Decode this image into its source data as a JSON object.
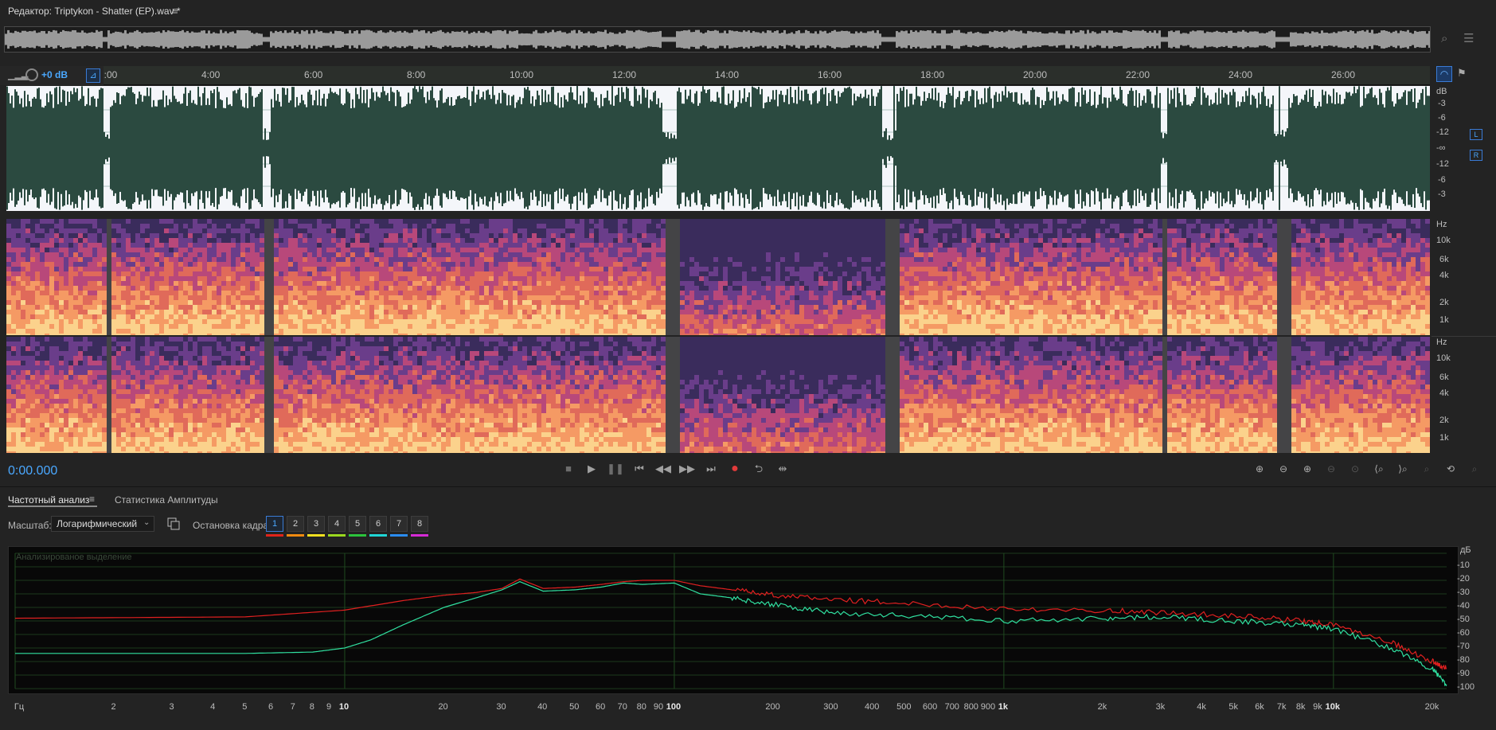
{
  "window": {
    "title": "Редактор: Triptykon - Shatter (EP).wav *"
  },
  "ruler": {
    "gain": "+0 dB",
    "ticks": [
      "2:00",
      "4:00",
      "6:00",
      "8:00",
      "10:00",
      "12:00",
      "14:00",
      "16:00",
      "18:00",
      "20:00",
      "22:00",
      "24:00",
      "26:00"
    ]
  },
  "waveform": {
    "db_labels": [
      "dB",
      "-3",
      "-6",
      "-12",
      "-∞",
      "-12",
      "-6",
      "-3"
    ],
    "channels": [
      "L",
      "R"
    ]
  },
  "spectrogram": {
    "top_labels": [
      "Hz",
      "10k",
      "6k",
      "4k",
      "2k",
      "1k"
    ],
    "bottom_labels": [
      "Hz",
      "10k",
      "6k",
      "4k",
      "2k",
      "1k"
    ]
  },
  "transport": {
    "timecode": "0:00.000",
    "buttons": [
      "stop-icon",
      "play-icon",
      "pause-icon",
      "skip-start-icon",
      "rewind-icon",
      "fast-forward-icon",
      "skip-end-icon",
      "record-icon",
      "loop-icon",
      "skip-selection-icon"
    ],
    "zoom_buttons": [
      "zoom-in-amplitude-icon",
      "zoom-out-amplitude-icon",
      "zoom-in-time-icon",
      "zoom-out-time-icon",
      "zoom-full-icon",
      "zoom-in-start-icon",
      "zoom-in-end-icon",
      "zoom-selection-icon",
      "zoom-reset-icon",
      "zoom-tracks-icon"
    ]
  },
  "panel": {
    "tabs": [
      "Частотный анализ",
      "Статистика Амплитуды"
    ],
    "scale_label": "Масштаб:",
    "scale_value": "Логарифмический",
    "hold_label": "Остановка кадра:",
    "hold_buttons": [
      "1",
      "2",
      "3",
      "4",
      "5",
      "6",
      "7",
      "8"
    ],
    "hold_colors": [
      "#e0241b",
      "#f08a10",
      "#f2e020",
      "#9ad81e",
      "#2bc43c",
      "#1fd6d6",
      "#2a8cf0",
      "#d62ad6"
    ],
    "analysis_note": "Анализированое выделение"
  },
  "chart_data": {
    "type": "line",
    "title": "",
    "xlabel": "Гц",
    "ylabel": "дБ",
    "x_scale": "log",
    "xlim": [
      1,
      22050
    ],
    "ylim": [
      -100,
      0
    ],
    "x_tick_labels": [
      "Гц",
      "2",
      "3",
      "4",
      "5",
      "6",
      "7",
      "8",
      "9",
      "10",
      "20",
      "30",
      "40",
      "50",
      "60",
      "70",
      "80",
      "90",
      "100",
      "200",
      "300",
      "400",
      "500",
      "600",
      "700",
      "800",
      "900",
      "1k",
      "2k",
      "3k",
      "4k",
      "5k",
      "6k",
      "7k",
      "8k",
      "9k",
      "10k",
      "20k"
    ],
    "y_tick_labels": [
      "дБ",
      "-10",
      "-20",
      "-30",
      "-40",
      "-50",
      "-60",
      "-70",
      "-80",
      "-90",
      "-100"
    ],
    "grid": true,
    "series": [
      {
        "color": "#e02020",
        "x": [
          1,
          5,
          10,
          15,
          20,
          25,
          30,
          34,
          40,
          50,
          60,
          70,
          80,
          100,
          120,
          150,
          200,
          300,
          500,
          1000,
          2000,
          3000,
          5000,
          8000,
          10000,
          15000,
          20000,
          22050
        ],
        "y": [
          -48,
          -47,
          -42,
          -35,
          -31,
          -29,
          -26,
          -19,
          -26,
          -25,
          -23,
          -21,
          -20,
          -20,
          -24,
          -27,
          -31,
          -34,
          -37,
          -41,
          -42,
          -44,
          -46,
          -50,
          -53,
          -66,
          -80,
          -85
        ]
      },
      {
        "color": "#30e0a0",
        "x": [
          1,
          5,
          8,
          10,
          12,
          15,
          20,
          25,
          30,
          34,
          40,
          50,
          60,
          70,
          80,
          100,
          120,
          150,
          200,
          300,
          500,
          1000,
          2000,
          3000,
          5000,
          8000,
          10000,
          15000,
          20000,
          22050
        ],
        "y": [
          -74,
          -74,
          -73,
          -70,
          -64,
          -53,
          -40,
          -33,
          -27,
          -21,
          -28,
          -27,
          -25,
          -22,
          -23,
          -22,
          -30,
          -33,
          -38,
          -44,
          -46,
          -50,
          -48,
          -47,
          -50,
          -53,
          -56,
          -70,
          -86,
          -97
        ]
      }
    ]
  }
}
